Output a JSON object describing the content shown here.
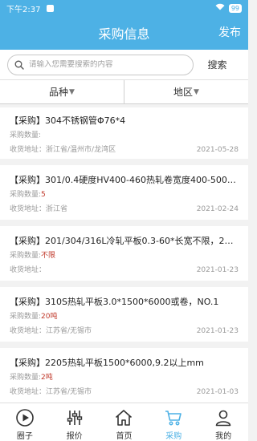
{
  "status_bar": {
    "time": "下午2:37",
    "battery": "99"
  },
  "header": {
    "title": "采购信息",
    "publish_label": "发布"
  },
  "search": {
    "placeholder": "请输入您需要搜索的内容",
    "button_label": "搜索"
  },
  "filters": [
    {
      "label": "品种"
    },
    {
      "label": "地区"
    }
  ],
  "listings": [
    {
      "title": "【采购】304不锈钢管Φ76*4",
      "qty_label": "采购数量:",
      "qty_value": "",
      "address": "收货地址：浙江省/温州市/龙湾区",
      "date": "2021-05-28"
    },
    {
      "title": "【采购】301/0.4硬度HV400-460热轧卷宽度400-500…",
      "qty_label": "采购数量:",
      "qty_value": "5",
      "address": "收货地址：浙江省",
      "date": "2021-02-24"
    },
    {
      "title": "【采购】201/304/316L冷轧平板0.3-60*长宽不限，2…",
      "qty_label": "采购数量:",
      "qty_value": "不限",
      "address": "收货地址：",
      "date": "2021-01-23"
    },
    {
      "title": "【采购】310S热轧平板3.0*1500*6000或卷，NO.1",
      "qty_label": "采购数量:",
      "qty_value": "20吨",
      "address": "收货地址：江苏省/无锡市",
      "date": "2021-01-23"
    },
    {
      "title": "【采购】2205热轧平板1500*6000,9.2以上mm",
      "qty_label": "采购数量:",
      "qty_value": "2吨",
      "address": "收货地址：江苏省/无锡市",
      "date": "2021-01-03"
    }
  ],
  "tabs": [
    {
      "label": "圈子",
      "icon": "circle-play-icon"
    },
    {
      "label": "报价",
      "icon": "sliders-icon"
    },
    {
      "label": "首页",
      "icon": "home-icon"
    },
    {
      "label": "采购",
      "icon": "cart-icon",
      "active": true
    },
    {
      "label": "我的",
      "icon": "user-icon"
    }
  ],
  "colors": {
    "primary": "#4db1e5",
    "qty_highlight": "#c0392b"
  }
}
